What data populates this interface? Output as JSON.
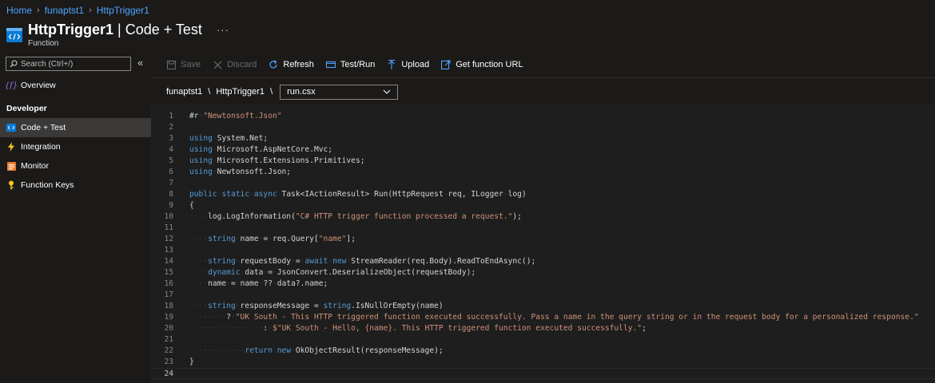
{
  "breadcrumb": {
    "items": [
      "Home",
      "funaptst1",
      "HttpTrigger1"
    ]
  },
  "header": {
    "title_bold": "HttpTrigger1",
    "title_rest": " | Code + Test",
    "subtitle": "Function",
    "more_label": "···"
  },
  "sidebar": {
    "search_placeholder": "Search (Ctrl+/)",
    "collapse_label": "«",
    "overview_label": "Overview",
    "section_developer": "Developer",
    "items": [
      {
        "label": "Code + Test",
        "icon": "code-icon"
      },
      {
        "label": "Integration",
        "icon": "lightning-icon"
      },
      {
        "label": "Monitor",
        "icon": "monitor-icon"
      },
      {
        "label": "Function Keys",
        "icon": "key-icon"
      }
    ]
  },
  "toolbar": {
    "save_label": "Save",
    "discard_label": "Discard",
    "refresh_label": "Refresh",
    "testrun_label": "Test/Run",
    "upload_label": "Upload",
    "geturl_label": "Get function URL"
  },
  "pathbar": {
    "app": "funaptst1",
    "function": "HttpTrigger1",
    "separator": "\\",
    "file": "run.csx"
  },
  "editor": {
    "current_line": 24,
    "lines": [
      "#r \"Newtonsoft.Json\"",
      "",
      "using System.Net;",
      "using Microsoft.AspNetCore.Mvc;",
      "using Microsoft.Extensions.Primitives;",
      "using Newtonsoft.Json;",
      "",
      "public static async Task<IActionResult> Run(HttpRequest req, ILogger log)",
      "{",
      "    log.LogInformation(\"C# HTTP trigger function processed a request.\");",
      "",
      "    string name = req.Query[\"name\"];",
      "",
      "    string requestBody = await new StreamReader(req.Body).ReadToEndAsync();",
      "    dynamic data = JsonConvert.DeserializeObject(requestBody);",
      "    name = name ?? data?.name;",
      "",
      "    string responseMessage = string.IsNullOrEmpty(name)",
      "        ? \"UK South - This HTTP triggered function executed successfully. Pass a name in the query string or in the request body for a personalized response.\"",
      "                : $\"UK South - Hello, {name}. This HTTP triggered function executed successfully.\";",
      "",
      "            return new OkObjectResult(responseMessage);",
      "}",
      ""
    ]
  },
  "colors": {
    "accent": "#4da3ff",
    "keyword": "#569cd6",
    "string": "#ce9178",
    "editor_bg": "#1e1e1e",
    "app_bg": "#1b1a19"
  }
}
